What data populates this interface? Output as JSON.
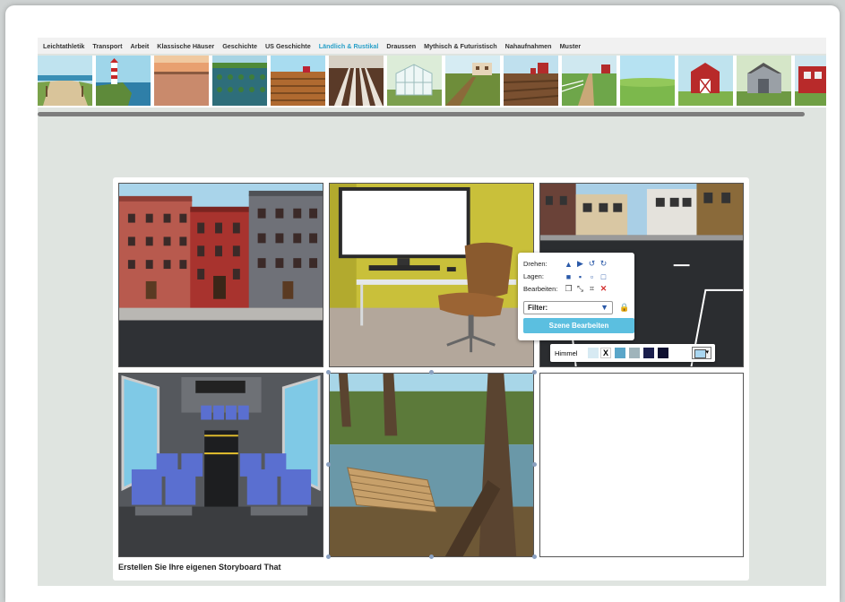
{
  "tabs": [
    {
      "label": "Leichtathletik",
      "active": false
    },
    {
      "label": "Transport",
      "active": false
    },
    {
      "label": "Arbeit",
      "active": false
    },
    {
      "label": "Klassische Häuser",
      "active": false
    },
    {
      "label": "Geschichte",
      "active": false
    },
    {
      "label": "US Geschichte",
      "active": false
    },
    {
      "label": "Ländlich & Rustikal",
      "active": true
    },
    {
      "label": "Draussen",
      "active": false
    },
    {
      "label": "Mythisch & Futuristisch",
      "active": false
    },
    {
      "label": "Nahaufnahmen",
      "active": false
    },
    {
      "label": "Muster",
      "active": false
    }
  ],
  "thumbnails": [
    "beach-path",
    "lighthouse",
    "field-sunset",
    "vineyard-water",
    "plowed-field",
    "dirt-rows",
    "greenhouse",
    "farm-rows",
    "farm-barn-field",
    "farm-fence-road",
    "meadow",
    "red-barn",
    "grey-barn",
    "red-shed"
  ],
  "popup": {
    "rotate_label": "Drehen:",
    "layers_label": "Lagen:",
    "edit_label": "Bearbeiten:",
    "filter_value": "Filter:",
    "edit_scene_button": "Szene Bearbeiten"
  },
  "sky": {
    "label": "Himmel",
    "none_mark": "X",
    "colors": [
      "#d7eaf3",
      "#ffffff",
      "#5aa6c9",
      "#9fb4bb",
      "#1b1f4d",
      "#0e1030"
    ],
    "selected": "#a9d6f0"
  },
  "caption": "Erstellen Sie Ihre eigenen Storyboard That",
  "colors": {
    "accent": "#2aa0c8",
    "button": "#5bbfe0",
    "board_bg": "#dfe4e0"
  }
}
